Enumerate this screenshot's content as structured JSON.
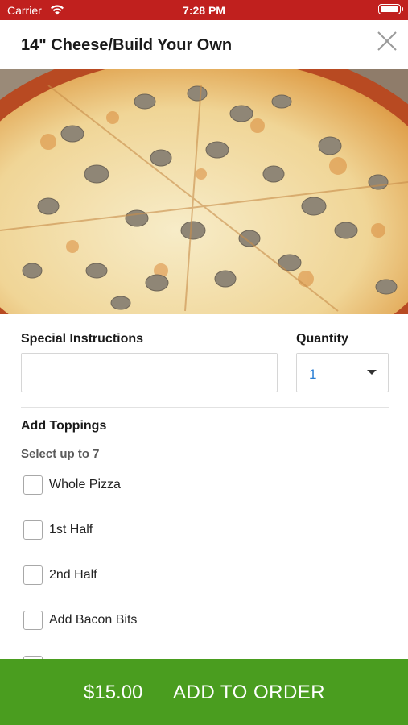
{
  "status_bar": {
    "carrier": "Carrier",
    "time": "7:28 PM",
    "icons": [
      "wifi-icon",
      "battery-icon"
    ]
  },
  "item": {
    "title": "14\" Cheese/Build Your Own",
    "close_icon": "close-icon",
    "image": "pizza-photo"
  },
  "form": {
    "instructions_label": "Special Instructions",
    "instructions_value": "",
    "quantity_label": "Quantity",
    "quantity_value": "1"
  },
  "toppings": {
    "title": "Add Toppings",
    "subtitle": "Select up to 7",
    "options": [
      {
        "label": "Whole Pizza",
        "checked": false
      },
      {
        "label": "1st Half",
        "checked": false
      },
      {
        "label": "2nd Half",
        "checked": false
      },
      {
        "label": "Add Bacon Bits",
        "checked": false
      },
      {
        "label": "",
        "checked": false
      }
    ]
  },
  "order_bar": {
    "price": "$15.00",
    "label": "ADD TO ORDER"
  },
  "colors": {
    "status_bar": "#c0201e",
    "order_bar": "#4a9d1f",
    "quantity_text": "#2b7fd4"
  }
}
